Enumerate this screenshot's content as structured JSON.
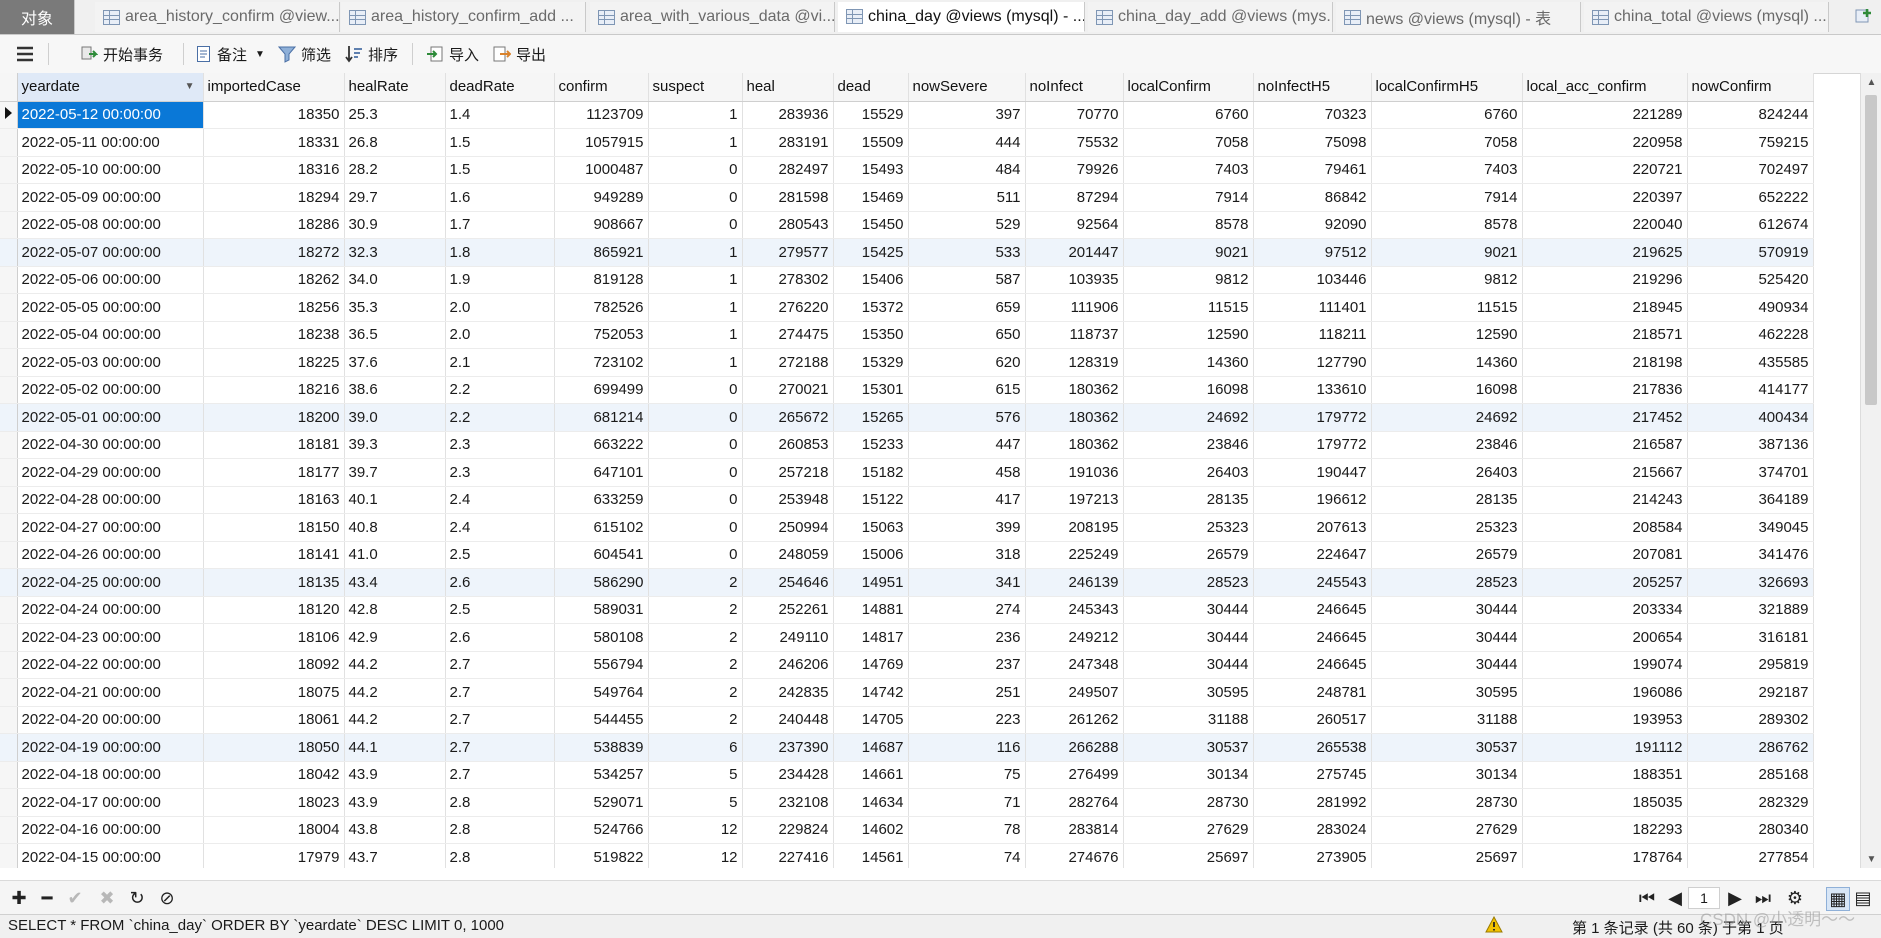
{
  "tabs": [
    {
      "label": "对象",
      "type": "objects",
      "active": false
    },
    {
      "label": "area_history_confirm @view...",
      "active": false
    },
    {
      "label": "area_history_confirm_add ...",
      "active": false
    },
    {
      "label": "area_with_various_data @vi...",
      "active": false
    },
    {
      "label": "china_day @views (mysql) - ...",
      "active": true
    },
    {
      "label": "china_day_add @views (mys...",
      "active": false
    },
    {
      "label": "news @views (mysql) - 表",
      "active": false
    },
    {
      "label": "china_total @views (mysql) ...",
      "active": false
    }
  ],
  "toolbar": {
    "begin_transaction": "开始事务",
    "memo": "备注",
    "filter": "筛选",
    "sort": "排序",
    "import": "导入",
    "export": "导出"
  },
  "columns": [
    "yeardate",
    "importedCase",
    "healRate",
    "deadRate",
    "confirm",
    "suspect",
    "heal",
    "dead",
    "nowSevere",
    "noInfect",
    "localConfirm",
    "noInfectH5",
    "localConfirmH5",
    "local_acc_confirm",
    "nowConfirm"
  ],
  "rows": [
    [
      "2022-05-12 00:00:00",
      "18350",
      "25.3",
      "1.4",
      "1123709",
      "1",
      "283936",
      "15529",
      "397",
      "70770",
      "6760",
      "70323",
      "6760",
      "221289",
      "824244"
    ],
    [
      "2022-05-11 00:00:00",
      "18331",
      "26.8",
      "1.5",
      "1057915",
      "1",
      "283191",
      "15509",
      "444",
      "75532",
      "7058",
      "75098",
      "7058",
      "220958",
      "759215"
    ],
    [
      "2022-05-10 00:00:00",
      "18316",
      "28.2",
      "1.5",
      "1000487",
      "0",
      "282497",
      "15493",
      "484",
      "79926",
      "7403",
      "79461",
      "7403",
      "220721",
      "702497"
    ],
    [
      "2022-05-09 00:00:00",
      "18294",
      "29.7",
      "1.6",
      "949289",
      "0",
      "281598",
      "15469",
      "511",
      "87294",
      "7914",
      "86842",
      "7914",
      "220397",
      "652222"
    ],
    [
      "2022-05-08 00:00:00",
      "18286",
      "30.9",
      "1.7",
      "908667",
      "0",
      "280543",
      "15450",
      "529",
      "92564",
      "8578",
      "92090",
      "8578",
      "220040",
      "612674"
    ],
    [
      "2022-05-07 00:00:00",
      "18272",
      "32.3",
      "1.8",
      "865921",
      "1",
      "279577",
      "15425",
      "533",
      "201447",
      "9021",
      "97512",
      "9021",
      "219625",
      "570919"
    ],
    [
      "2022-05-06 00:00:00",
      "18262",
      "34.0",
      "1.9",
      "819128",
      "1",
      "278302",
      "15406",
      "587",
      "103935",
      "9812",
      "103446",
      "9812",
      "219296",
      "525420"
    ],
    [
      "2022-05-05 00:00:00",
      "18256",
      "35.3",
      "2.0",
      "782526",
      "1",
      "276220",
      "15372",
      "659",
      "111906",
      "11515",
      "111401",
      "11515",
      "218945",
      "490934"
    ],
    [
      "2022-05-04 00:00:00",
      "18238",
      "36.5",
      "2.0",
      "752053",
      "1",
      "274475",
      "15350",
      "650",
      "118737",
      "12590",
      "118211",
      "12590",
      "218571",
      "462228"
    ],
    [
      "2022-05-03 00:00:00",
      "18225",
      "37.6",
      "2.1",
      "723102",
      "1",
      "272188",
      "15329",
      "620",
      "128319",
      "14360",
      "127790",
      "14360",
      "218198",
      "435585"
    ],
    [
      "2022-05-02 00:00:00",
      "18216",
      "38.6",
      "2.2",
      "699499",
      "0",
      "270021",
      "15301",
      "615",
      "180362",
      "16098",
      "133610",
      "16098",
      "217836",
      "414177"
    ],
    [
      "2022-05-01 00:00:00",
      "18200",
      "39.0",
      "2.2",
      "681214",
      "0",
      "265672",
      "15265",
      "576",
      "180362",
      "24692",
      "179772",
      "24692",
      "217452",
      "400434"
    ],
    [
      "2022-04-30 00:00:00",
      "18181",
      "39.3",
      "2.3",
      "663222",
      "0",
      "260853",
      "15233",
      "447",
      "180362",
      "23846",
      "179772",
      "23846",
      "216587",
      "387136"
    ],
    [
      "2022-04-29 00:00:00",
      "18177",
      "39.7",
      "2.3",
      "647101",
      "0",
      "257218",
      "15182",
      "458",
      "191036",
      "26403",
      "190447",
      "26403",
      "215667",
      "374701"
    ],
    [
      "2022-04-28 00:00:00",
      "18163",
      "40.1",
      "2.4",
      "633259",
      "0",
      "253948",
      "15122",
      "417",
      "197213",
      "28135",
      "196612",
      "28135",
      "214243",
      "364189"
    ],
    [
      "2022-04-27 00:00:00",
      "18150",
      "40.8",
      "2.4",
      "615102",
      "0",
      "250994",
      "15063",
      "399",
      "208195",
      "25323",
      "207613",
      "25323",
      "208584",
      "349045"
    ],
    [
      "2022-04-26 00:00:00",
      "18141",
      "41.0",
      "2.5",
      "604541",
      "0",
      "248059",
      "15006",
      "318",
      "225249",
      "26579",
      "224647",
      "26579",
      "207081",
      "341476"
    ],
    [
      "2022-04-25 00:00:00",
      "18135",
      "43.4",
      "2.6",
      "586290",
      "2",
      "254646",
      "14951",
      "341",
      "246139",
      "28523",
      "245543",
      "28523",
      "205257",
      "326693"
    ],
    [
      "2022-04-24 00:00:00",
      "18120",
      "42.8",
      "2.5",
      "589031",
      "2",
      "252261",
      "14881",
      "274",
      "245343",
      "30444",
      "246645",
      "30444",
      "203334",
      "321889"
    ],
    [
      "2022-04-23 00:00:00",
      "18106",
      "42.9",
      "2.6",
      "580108",
      "2",
      "249110",
      "14817",
      "236",
      "249212",
      "30444",
      "246645",
      "30444",
      "200654",
      "316181"
    ],
    [
      "2022-04-22 00:00:00",
      "18092",
      "44.2",
      "2.7",
      "556794",
      "2",
      "246206",
      "14769",
      "237",
      "247348",
      "30444",
      "246645",
      "30444",
      "199074",
      "295819"
    ],
    [
      "2022-04-21 00:00:00",
      "18075",
      "44.2",
      "2.7",
      "549764",
      "2",
      "242835",
      "14742",
      "251",
      "249507",
      "30595",
      "248781",
      "30595",
      "196086",
      "292187"
    ],
    [
      "2022-04-20 00:00:00",
      "18061",
      "44.2",
      "2.7",
      "544455",
      "2",
      "240448",
      "14705",
      "223",
      "261262",
      "31188",
      "260517",
      "31188",
      "193953",
      "289302"
    ],
    [
      "2022-04-19 00:00:00",
      "18050",
      "44.1",
      "2.7",
      "538839",
      "6",
      "237390",
      "14687",
      "116",
      "266288",
      "30537",
      "265538",
      "30537",
      "191112",
      "286762"
    ],
    [
      "2022-04-18 00:00:00",
      "18042",
      "43.9",
      "2.7",
      "534257",
      "5",
      "234428",
      "14661",
      "75",
      "276499",
      "30134",
      "275745",
      "30134",
      "188351",
      "285168"
    ],
    [
      "2022-04-17 00:00:00",
      "18023",
      "43.9",
      "2.8",
      "529071",
      "5",
      "232108",
      "14634",
      "71",
      "282764",
      "28730",
      "281992",
      "28730",
      "185035",
      "282329"
    ],
    [
      "2022-04-16 00:00:00",
      "18004",
      "43.8",
      "2.8",
      "524766",
      "12",
      "229824",
      "14602",
      "78",
      "283814",
      "27629",
      "283024",
      "27629",
      "182293",
      "280340"
    ],
    [
      "2022-04-15 00:00:00",
      "17979",
      "43.7",
      "2.8",
      "519822",
      "12",
      "227416",
      "14561",
      "74",
      "274676",
      "25697",
      "273905",
      "25697",
      "178764",
      "277854"
    ]
  ],
  "navigation": {
    "page": "1"
  },
  "status": {
    "sql": "SELECT * FROM `china_day` ORDER BY `yeardate` DESC LIMIT 0, 1000",
    "record": "第 1 条记录 (共 60 条) 于第 1 页",
    "watermark": "CSDN @小透明～～"
  }
}
